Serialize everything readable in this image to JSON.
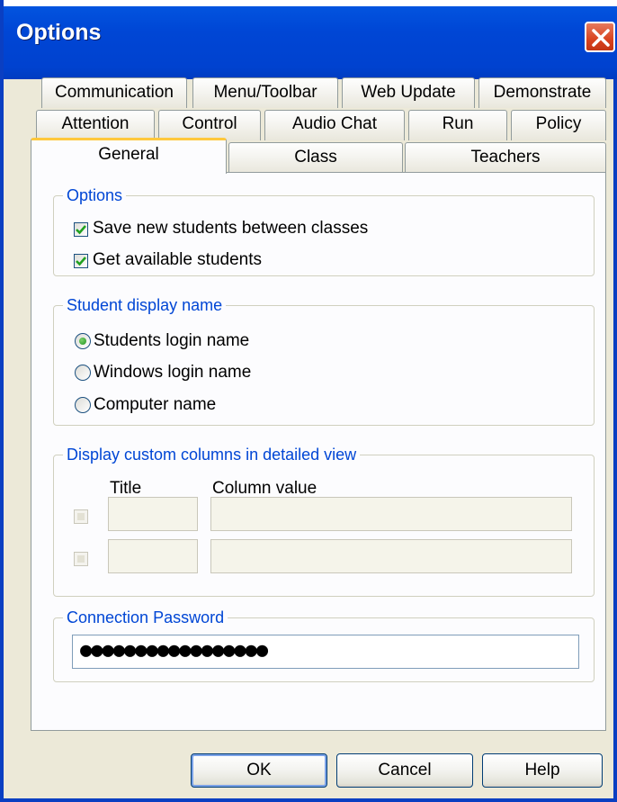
{
  "window": {
    "title": "Options"
  },
  "tabs": {
    "row1": [
      "Communication",
      "Menu/Toolbar",
      "Web Update",
      "Demonstrate"
    ],
    "row2": [
      "Attention",
      "Control",
      "Audio Chat",
      "Run",
      "Policy"
    ],
    "row3": [
      "General",
      "Class",
      "Teachers"
    ],
    "active": "General"
  },
  "options_group": {
    "legend": "Options",
    "items": [
      {
        "label": "Save new students between classes",
        "checked": true
      },
      {
        "label": "Get available students",
        "checked": true
      }
    ]
  },
  "display_name_group": {
    "legend": "Student display name",
    "items": [
      {
        "label": "Students login name",
        "selected": true
      },
      {
        "label": "Windows login name",
        "selected": false
      },
      {
        "label": "Computer name",
        "selected": false
      }
    ]
  },
  "custom_columns_group": {
    "legend": "Display custom columns in detailed view",
    "title_header": "Title",
    "value_header": "Column value",
    "rows": [
      {
        "enabled": false,
        "title": "",
        "value": ""
      },
      {
        "enabled": false,
        "title": "",
        "value": ""
      }
    ]
  },
  "password_group": {
    "legend": "Connection Password",
    "masked_value": "●●●●●●●●●●●●●●●●●"
  },
  "buttons": {
    "ok": "OK",
    "cancel": "Cancel",
    "help": "Help"
  },
  "colors": {
    "titlebar": "#0046d5",
    "legend_text": "#0046d5",
    "dialog_bg": "#ece9d8",
    "close_button": "#d9431f"
  }
}
